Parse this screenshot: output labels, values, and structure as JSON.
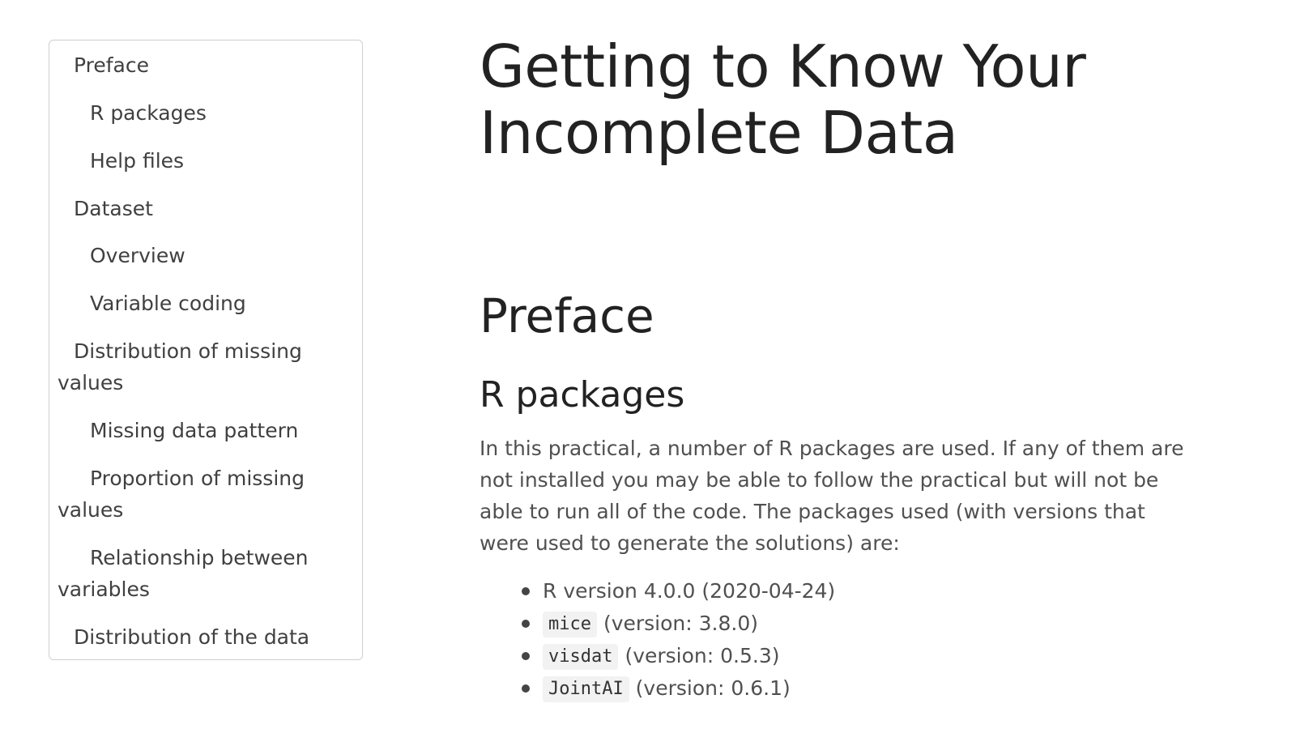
{
  "toc": {
    "items": [
      {
        "label": "Preface",
        "level": 1
      },
      {
        "label": "R packages",
        "level": 2
      },
      {
        "label": "Help files",
        "level": 2
      },
      {
        "label": "Dataset",
        "level": 1
      },
      {
        "label": "Overview",
        "level": 2
      },
      {
        "label": "Variable coding",
        "level": 2
      },
      {
        "label": "Distribution of missing values",
        "level": 1
      },
      {
        "label": "Missing data pattern",
        "level": 2
      },
      {
        "label": "Proportion of missing values",
        "level": 2
      },
      {
        "label": "Relationship between variables",
        "level": 2
      },
      {
        "label": "Distribution of the data",
        "level": 1
      }
    ]
  },
  "main": {
    "title": "Getting to Know Your Incomplete Data",
    "section_heading": "Preface",
    "subsection_heading": "R packages",
    "paragraph": "In this practical, a number of R packages are used. If any of them are not installed you may be able to follow the practical but will not be able to run all of the code. The packages used (with versions that were used to generate the solutions) are:",
    "packages": [
      {
        "code": "",
        "text": "R version 4.0.0 (2020-04-24)"
      },
      {
        "code": "mice",
        "text": "(version: 3.8.0)"
      },
      {
        "code": "visdat",
        "text": "(version: 0.5.3)"
      },
      {
        "code": "JointAI",
        "text": "(version: 0.6.1)"
      }
    ]
  }
}
